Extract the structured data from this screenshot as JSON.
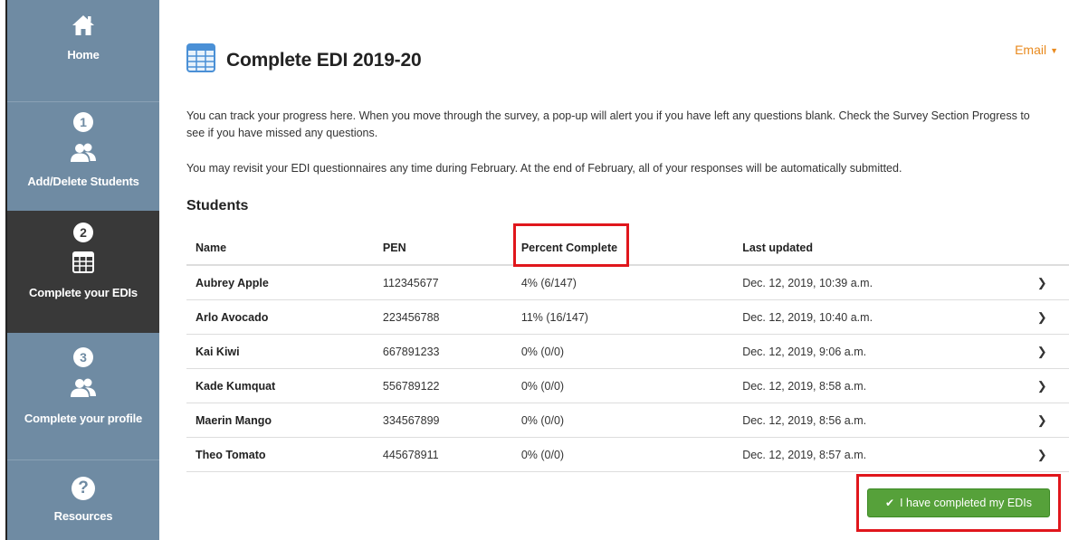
{
  "colors": {
    "sidebar_bg": "#6f8ba3",
    "sidebar_active_bg": "#393939",
    "accent_orange": "#e98a1e",
    "success_green": "#56a13a",
    "highlight_red": "#e0161c"
  },
  "sidebar": {
    "items": [
      {
        "label": "Home",
        "icon": "home-icon"
      },
      {
        "step": "1",
        "label": "Add/Delete Students",
        "icon": "people-icon"
      },
      {
        "step": "2",
        "label": "Complete your EDIs",
        "icon": "table-icon",
        "active": true
      },
      {
        "step": "3",
        "label": "Complete your profile",
        "icon": "people-icon"
      },
      {
        "label": "Resources",
        "icon": "question-icon"
      }
    ]
  },
  "header": {
    "title": "Complete EDI 2019-20",
    "title_icon": "table-icon",
    "email_menu": "Email"
  },
  "intro": {
    "paragraph1": "You can track your progress here. When you move through the survey, a pop-up will alert you if you have left any questions blank. Check the Survey Section Progress to see if you have missed any questions.",
    "paragraph2": "You may revisit your EDI questionnaires any time during February. At the end of February, all of your responses will be automatically submitted."
  },
  "students": {
    "heading": "Students",
    "columns": [
      "Name",
      "PEN",
      "Percent Complete",
      "Last updated"
    ],
    "rows": [
      {
        "name": "Aubrey Apple",
        "pen": "112345677",
        "percent": "4% (6/147)",
        "updated": "Dec. 12, 2019, 10:39 a.m."
      },
      {
        "name": "Arlo Avocado",
        "pen": "223456788",
        "percent": "11% (16/147)",
        "updated": "Dec. 12, 2019, 10:40 a.m."
      },
      {
        "name": "Kai Kiwi",
        "pen": "667891233",
        "percent": "0% (0/0)",
        "updated": "Dec. 12, 2019, 9:06 a.m."
      },
      {
        "name": "Kade Kumquat",
        "pen": "556789122",
        "percent": "0% (0/0)",
        "updated": "Dec. 12, 2019, 8:58 a.m."
      },
      {
        "name": "Maerin Mango",
        "pen": "334567899",
        "percent": "0% (0/0)",
        "updated": "Dec. 12, 2019, 8:56 a.m."
      },
      {
        "name": "Theo Tomato",
        "pen": "445678911",
        "percent": "0% (0/0)",
        "updated": "Dec. 12, 2019, 8:57 a.m."
      }
    ]
  },
  "complete_button": {
    "label": "I have completed my EDIs",
    "icon": "checkmark-icon"
  }
}
